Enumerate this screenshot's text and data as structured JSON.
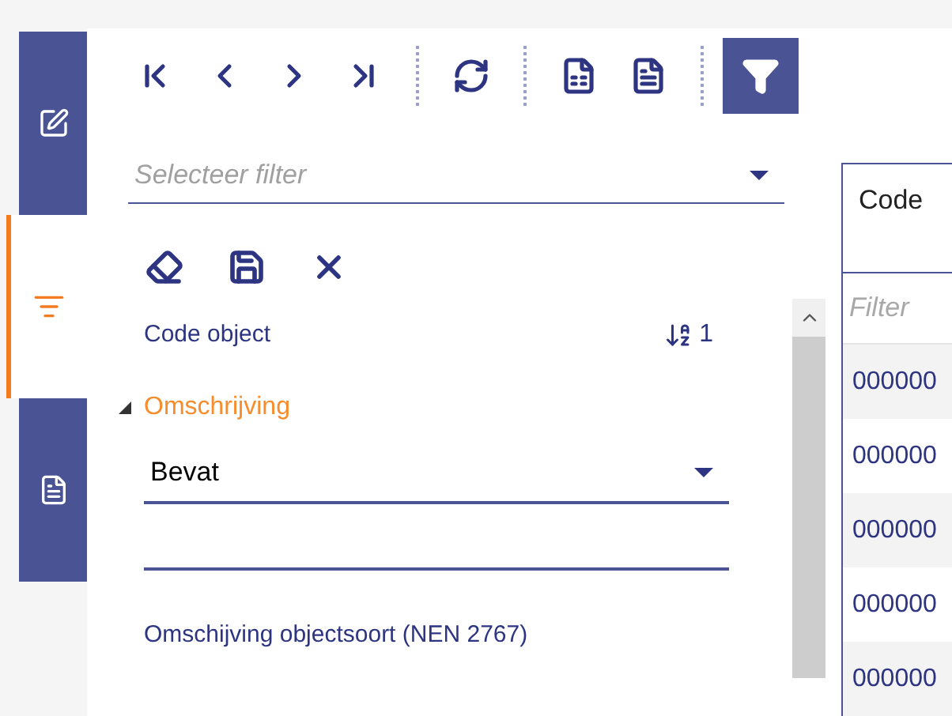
{
  "side_tabs": [
    {
      "kind": "edit",
      "selected": false
    },
    {
      "kind": "filter",
      "selected": true
    },
    {
      "kind": "document",
      "selected": false
    }
  ],
  "toolbar_groups": [
    [
      {
        "kind": "first"
      },
      {
        "kind": "prev"
      },
      {
        "kind": "next"
      },
      {
        "kind": "last"
      }
    ],
    [
      {
        "kind": "refresh"
      }
    ],
    [
      {
        "kind": "excel"
      },
      {
        "kind": "pdf"
      }
    ],
    [
      {
        "kind": "filter",
        "selected": true
      }
    ]
  ],
  "filter_select": {
    "placeholder": "Selecteer filter"
  },
  "filter_actions": [
    {
      "kind": "erase"
    },
    {
      "kind": "save"
    },
    {
      "kind": "close"
    }
  ],
  "fields": [
    {
      "label": "Code object",
      "sort_order": "1",
      "expanded": false,
      "active": false
    },
    {
      "label": "Omschrijving",
      "expanded": true,
      "active": true,
      "operator": "Bevat"
    },
    {
      "label": "Omschijving objectsoort (NEN 2767)",
      "expanded": false,
      "active": false
    }
  ],
  "grid": {
    "column": "Code",
    "filter_placeholder": "Filter",
    "rows": [
      "000000",
      "000000",
      "000000",
      "000000",
      "000000"
    ]
  }
}
